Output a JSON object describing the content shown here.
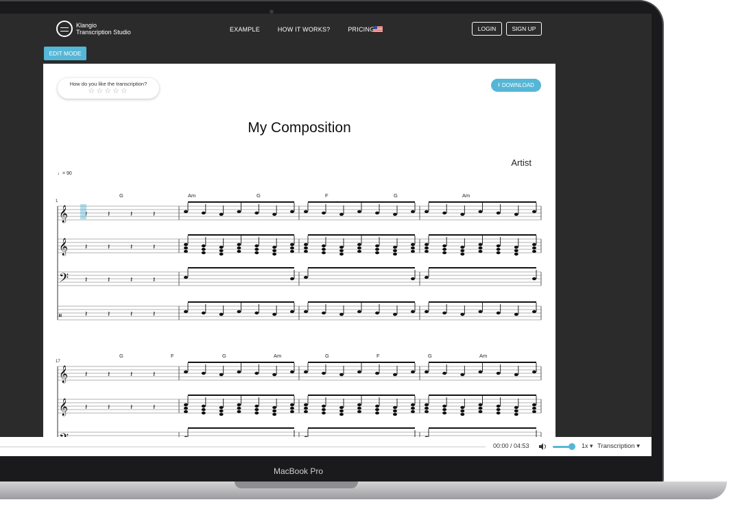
{
  "app": {
    "logo_line1": "Klangio",
    "logo_line2": "Transcription Studio"
  },
  "nav": {
    "items": [
      "EXAMPLE",
      "HOW IT WORKS?",
      "PRICING"
    ],
    "login": "LOGIN",
    "signup": "SIGN UP"
  },
  "edit_mode_label": "EDIT MODE",
  "rating": {
    "question": "How do you like the transcription?",
    "stars": "☆☆☆☆☆"
  },
  "download_label": "DOWNLOAD",
  "sheet": {
    "title": "My Composition",
    "artist": "Artist",
    "tempo": "= 90",
    "system1_number": "1",
    "system2_number": "17",
    "chords1": [
      "G",
      "Am",
      "G",
      "F",
      "G",
      "Am"
    ],
    "chords2": [
      "G",
      "F",
      "G",
      "Am",
      "G",
      "F",
      "G",
      "Am"
    ]
  },
  "player": {
    "time": "00:00 / 04:53",
    "speed": "1x ▾",
    "mode": "Transcription ▾"
  },
  "device_label": "MacBook Pro",
  "colors": {
    "accent": "#55b6d6",
    "screen_bg": "#2b2b2b"
  }
}
